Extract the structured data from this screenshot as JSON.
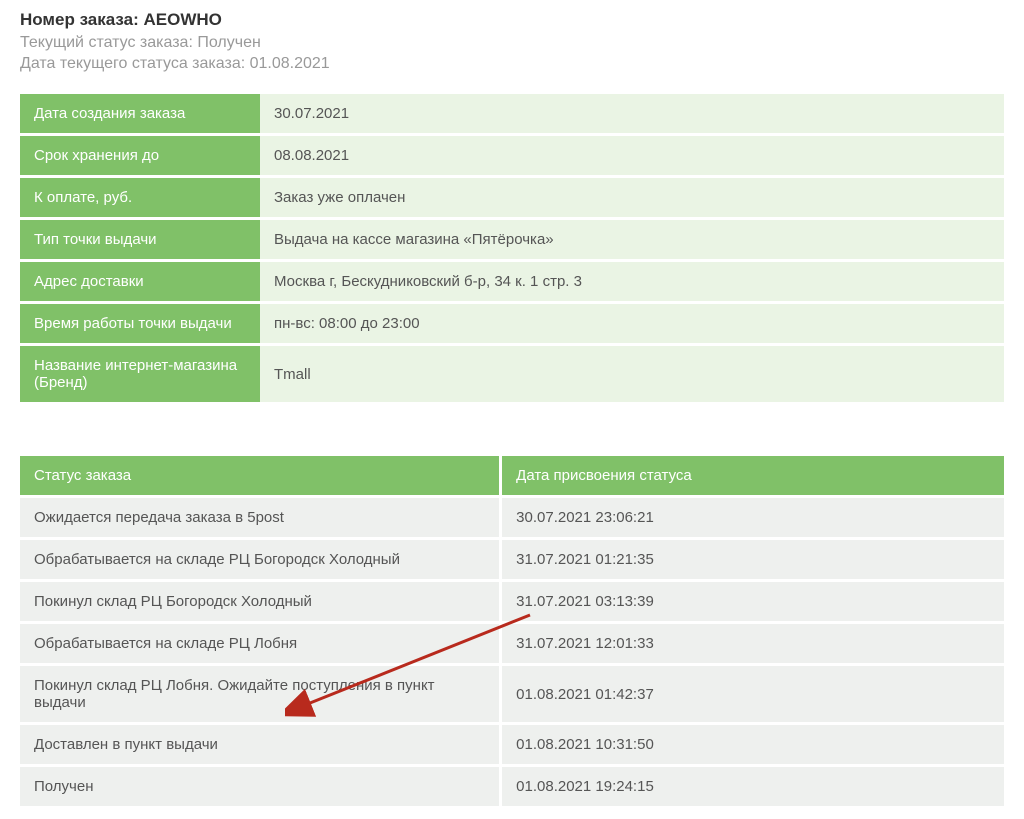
{
  "header": {
    "order_number_label": "Номер заказа: ",
    "order_number_value": "AEOWHO",
    "current_status_label": "Текущий статус заказа: ",
    "current_status_value": "Получен",
    "status_date_label": "Дата текущего статуса заказа: ",
    "status_date_value": "01.08.2021"
  },
  "details": [
    {
      "label": "Дата создания заказа",
      "value": "30.07.2021"
    },
    {
      "label": "Срок хранения до",
      "value": "08.08.2021"
    },
    {
      "label": "К оплате, руб.",
      "value": "Заказ уже оплачен"
    },
    {
      "label": "Тип точки выдачи",
      "value": "Выдача на кассе магазина «Пятёрочка»"
    },
    {
      "label": "Адрес доставки",
      "value": "Москва г, Бескудниковский б-р, 34 к. 1 стр. 3"
    },
    {
      "label": "Время работы точки выдачи",
      "value": "пн-вс: 08:00 до 23:00"
    },
    {
      "label": "Название интернет-магазина (Бренд)",
      "value": "Tmall"
    }
  ],
  "history": {
    "columns": [
      "Статус заказа",
      "Дата присвоения статуса"
    ],
    "rows": [
      {
        "status": "Ожидается передача заказа в 5post",
        "date": "30.07.2021 23:06:21"
      },
      {
        "status": "Обрабатывается на складе РЦ Богородск Холодный",
        "date": "31.07.2021 01:21:35"
      },
      {
        "status": "Покинул склад РЦ Богородск Холодный",
        "date": "31.07.2021 03:13:39"
      },
      {
        "status": "Обрабатывается на складе РЦ Лобня",
        "date": "31.07.2021 12:01:33"
      },
      {
        "status": "Покинул склад РЦ Лобня. Ожидайте поступления в пункт выдачи",
        "date": "01.08.2021 01:42:37"
      },
      {
        "status": "Доставлен в пункт выдачи",
        "date": "01.08.2021 10:31:50"
      },
      {
        "status": "Получен",
        "date": "01.08.2021 19:24:15"
      }
    ]
  }
}
